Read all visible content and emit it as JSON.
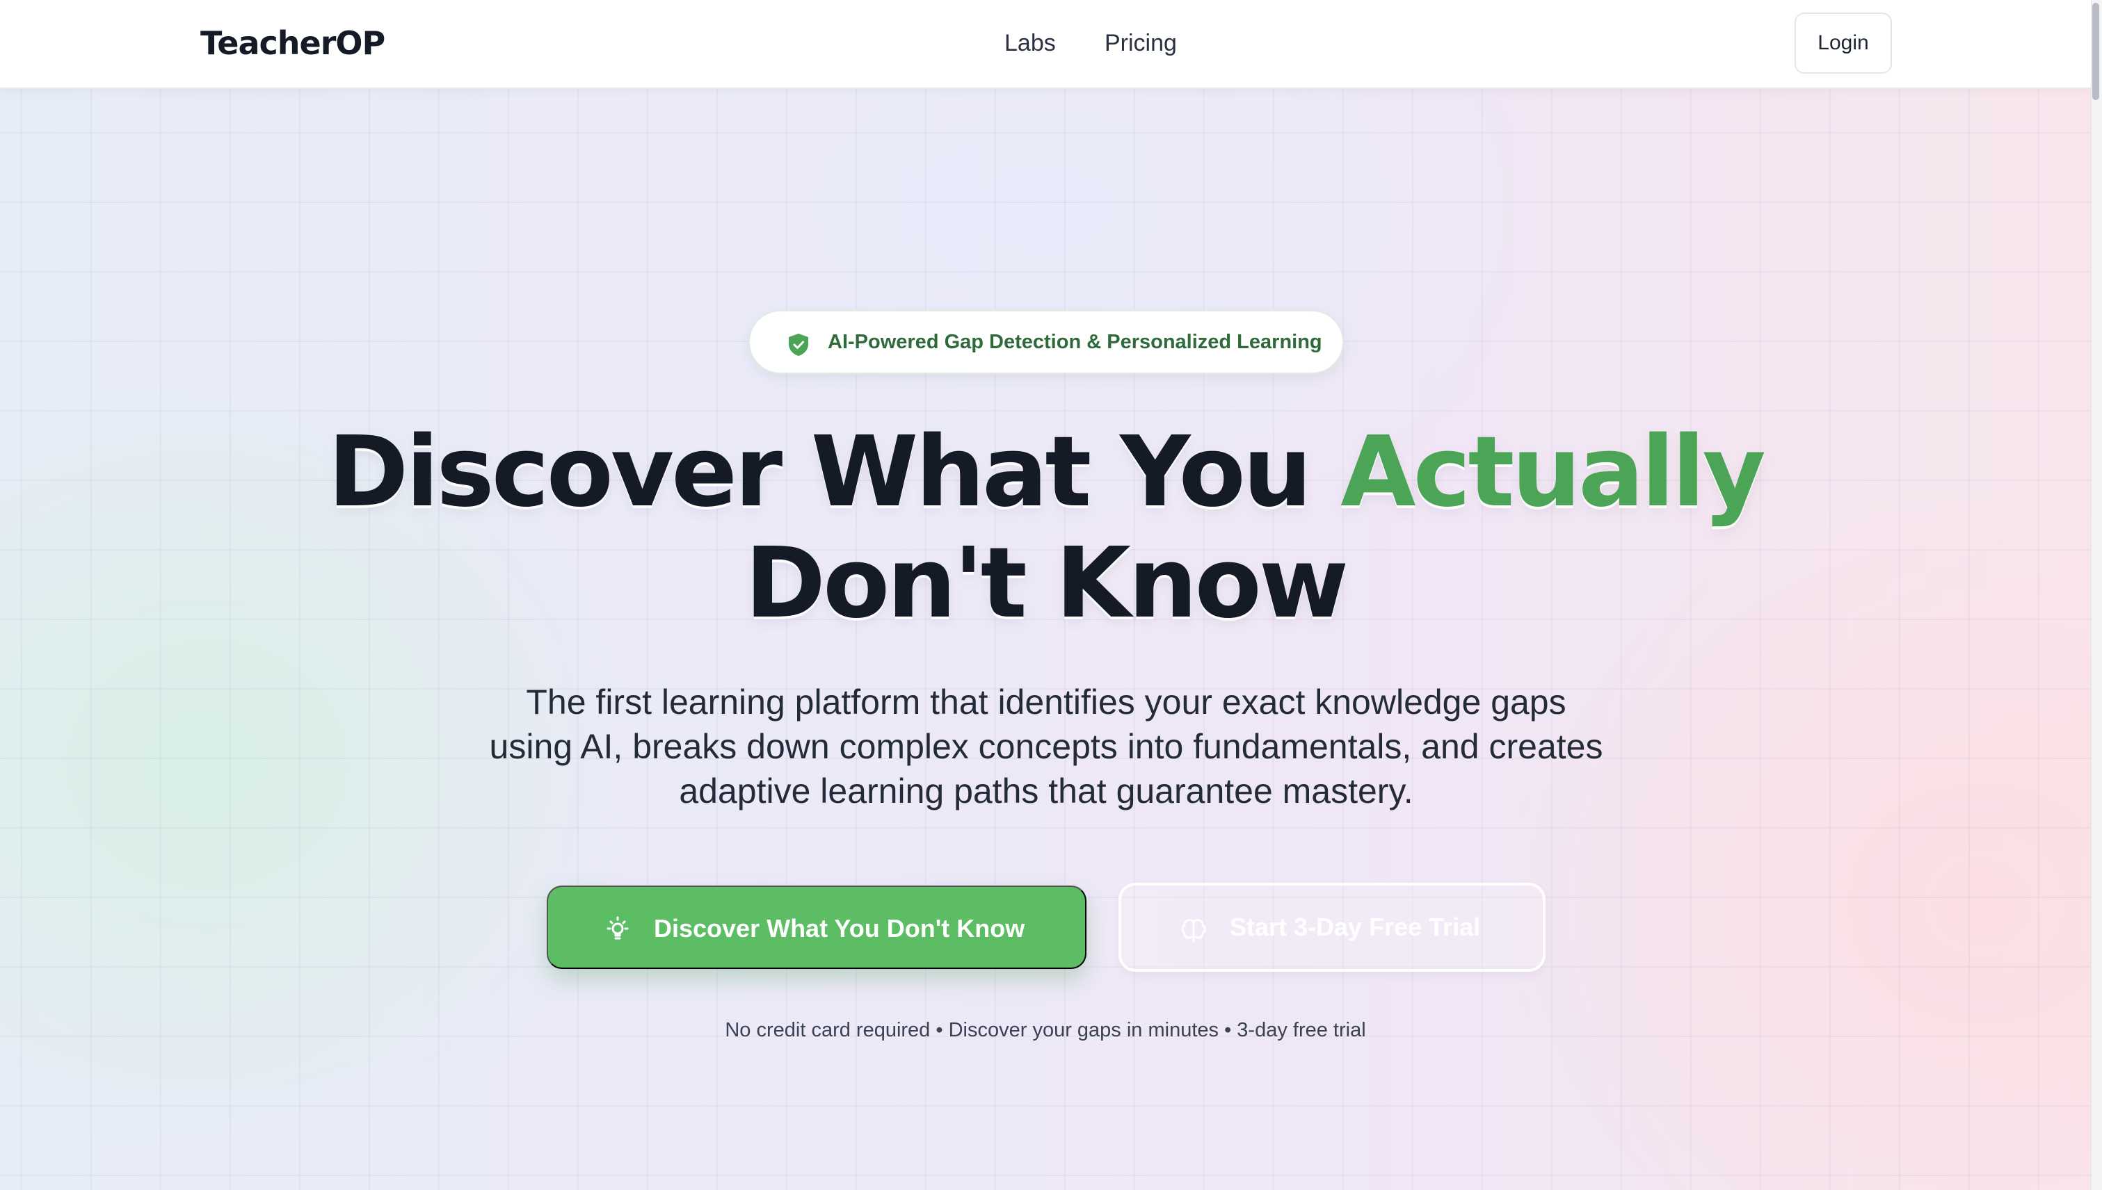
{
  "header": {
    "logo": "TeacherOP",
    "nav": [
      {
        "label": "Labs"
      },
      {
        "label": "Pricing"
      }
    ],
    "login_label": "Login"
  },
  "hero": {
    "badge": {
      "icon": "shield-check-icon",
      "text": "AI-Powered Gap Detection & Personalized Learning"
    },
    "headline": {
      "part1": "Discover What You ",
      "accent": "Actually",
      "line2": "Don't Know"
    },
    "subtext": "The first learning platform that identifies your exact knowledge gaps using AI, breaks down complex concepts into fundamentals, and creates adaptive learning paths that guarantee mastery.",
    "primary_cta": {
      "icon": "lightbulb-icon",
      "label": "Discover What You Don't Know"
    },
    "secondary_cta": {
      "icon": "brain-icon",
      "label": "Start 3-Day Free Trial"
    },
    "footnote": "No credit card required • Discover your gaps in minutes • 3-day free trial"
  },
  "colors": {
    "accent": "#4ca456",
    "primary_button": "#5cbd64",
    "badge_text": "#2f6b3a",
    "headline": "#141a26"
  }
}
